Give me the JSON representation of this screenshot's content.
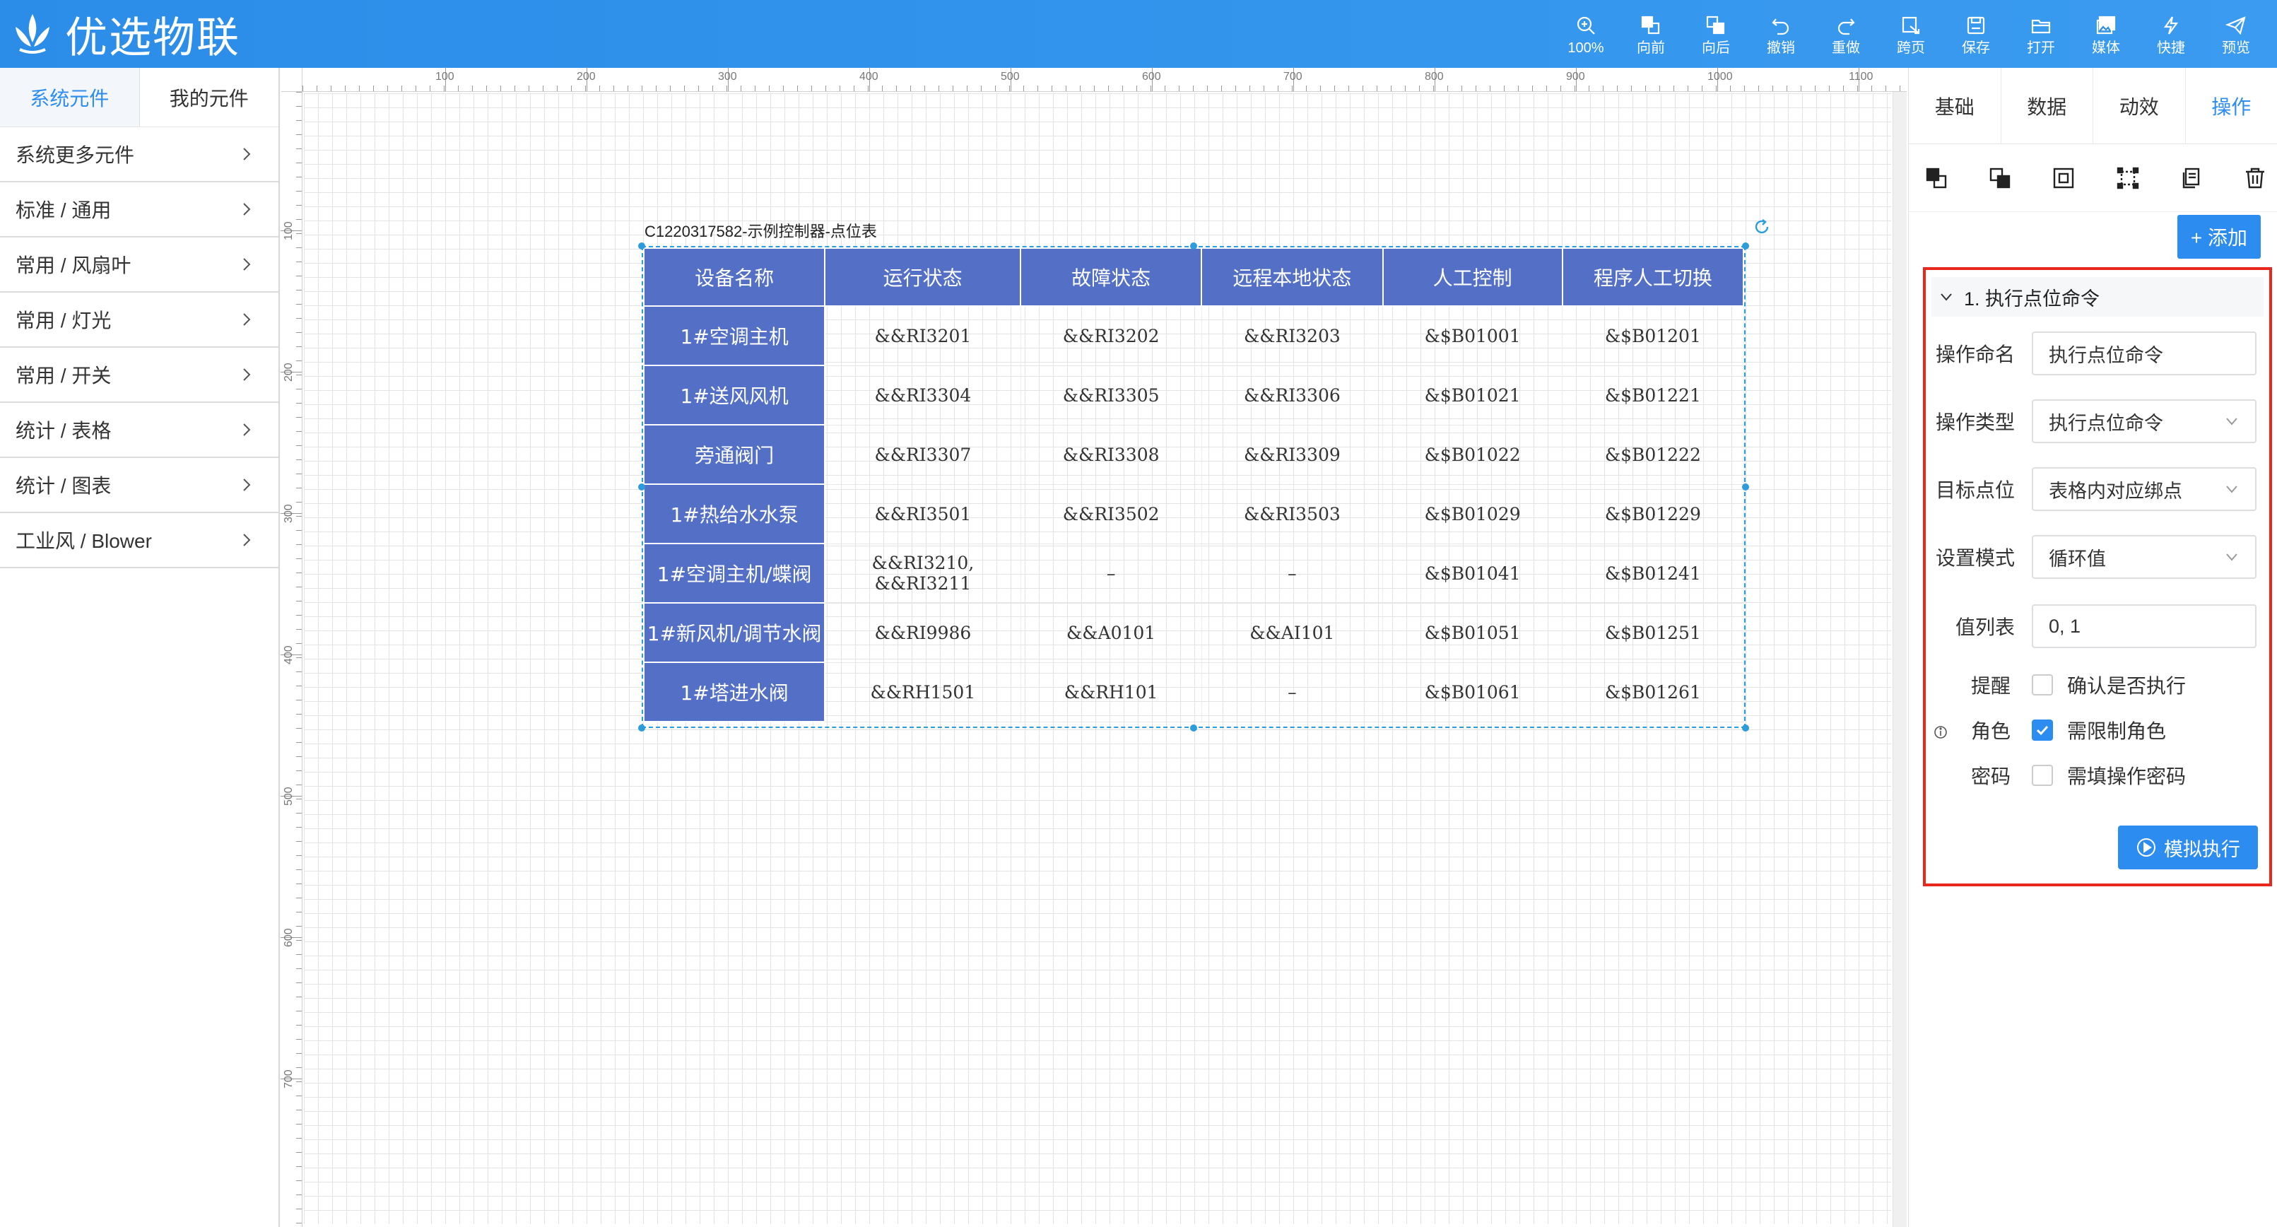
{
  "header": {
    "logo_text": "优选物联",
    "tools": [
      {
        "icon": "zoom-icon",
        "label": "100%"
      },
      {
        "icon": "bring-forward-icon",
        "label": "向前"
      },
      {
        "icon": "send-backward-icon",
        "label": "向后"
      },
      {
        "icon": "undo-icon",
        "label": "撤销"
      },
      {
        "icon": "redo-icon",
        "label": "重做"
      },
      {
        "icon": "cross-page-icon",
        "label": "跨页"
      },
      {
        "icon": "save-icon",
        "label": "保存"
      },
      {
        "icon": "open-folder-icon",
        "label": "打开"
      },
      {
        "icon": "media-icon",
        "label": "媒体"
      },
      {
        "icon": "lightning-icon",
        "label": "快捷"
      },
      {
        "icon": "send-icon",
        "label": "预览"
      }
    ]
  },
  "left_panel": {
    "tabs": [
      "系统元件",
      "我的元件"
    ],
    "active_tab": 0,
    "items": [
      "系统更多元件",
      "标准 / 通用",
      "常用 / 风扇叶",
      "常用 / 灯光",
      "常用 / 开关",
      "统计 / 表格",
      "统计 / 图表",
      "工业风 / Blower"
    ]
  },
  "ruler": {
    "top_labels": [
      "100",
      "200",
      "300",
      "400",
      "500",
      "600",
      "700",
      "800",
      "900",
      "1000",
      "1100"
    ],
    "left_labels": [
      "100",
      "200",
      "300",
      "400",
      "500",
      "600",
      "700"
    ]
  },
  "component": {
    "title": "C1220317582-示例控制器-点位表",
    "headers": [
      "设备名称",
      "运行状态",
      "故障状态",
      "远程本地状态",
      "人工控制",
      "程序人工切换"
    ],
    "rows": [
      [
        "1#空调主机",
        "&&RI3201",
        "&&RI3202",
        "&&RI3203",
        "&$B01001",
        "&$B01201"
      ],
      [
        "1#送风风机",
        "&&RI3304",
        "&&RI3305",
        "&&RI3306",
        "&$B01021",
        "&$B01221"
      ],
      [
        "旁通阀门",
        "&&RI3307",
        "&&RI3308",
        "&&RI3309",
        "&$B01022",
        "&$B01222"
      ],
      [
        "1#热给水水泵",
        "&&RI3501",
        "&&RI3502",
        "&&RI3503",
        "&$B01029",
        "&$B01229"
      ],
      [
        "1#空调主机/蝶阀",
        "&&RI3210, &&RI3211",
        "–",
        "–",
        "&$B01041",
        "&$B01241"
      ],
      [
        "1#新风机/调节水阀",
        "&&RI9986",
        "&&A0101",
        "&&AI101",
        "&$B01051",
        "&$B01251"
      ],
      [
        "1#塔进水阀",
        "&&RH1501",
        "&&RH101",
        "–",
        "&$B01061",
        "&$B01261"
      ]
    ]
  },
  "right_panel": {
    "tabs": [
      "基础",
      "数据",
      "动效",
      "操作"
    ],
    "active_tab": 3,
    "add_label": "+ 添加",
    "operation": {
      "title": "1. 执行点位命令",
      "fields": [
        {
          "label": "操作命名",
          "value": "执行点位命令",
          "type": "input"
        },
        {
          "label": "操作类型",
          "value": "执行点位命令",
          "type": "select"
        },
        {
          "label": "目标点位",
          "value": "表格内对应绑点",
          "type": "select"
        },
        {
          "label": "设置模式",
          "value": "循环值",
          "type": "select"
        },
        {
          "label": "值列表",
          "value": "0, 1",
          "type": "input"
        }
      ],
      "checks": [
        {
          "label": "提醒",
          "text": "确认是否执行",
          "checked": false
        },
        {
          "label": "角色",
          "text": "需限制角色",
          "checked": true
        },
        {
          "label": "密码",
          "text": "需填操作密码",
          "checked": false
        }
      ],
      "simulate_label": "模拟执行"
    }
  },
  "colors": {
    "header_blue": "#2b8de8",
    "table_header": "#5470c6",
    "accent": "#2d8cf0",
    "highlight_border": "#e8271d"
  }
}
